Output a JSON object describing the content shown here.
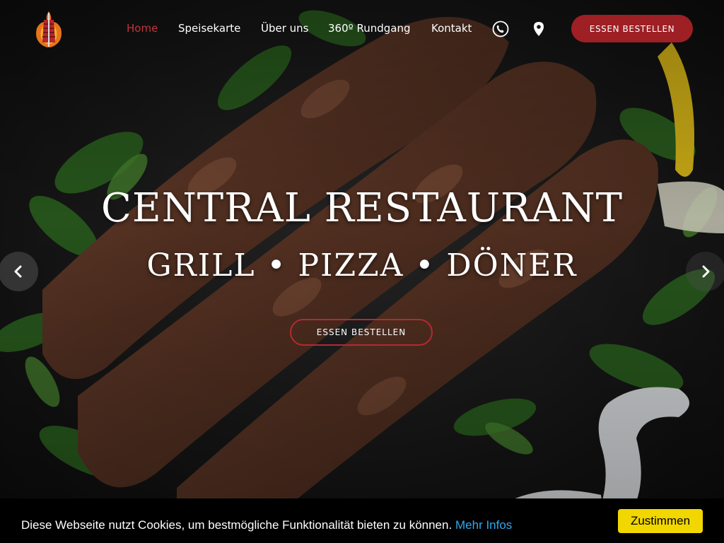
{
  "nav": {
    "items": [
      {
        "label": "Home",
        "active": true
      },
      {
        "label": "Speisekarte",
        "active": false
      },
      {
        "label": "Über uns",
        "active": false
      },
      {
        "label": "360º Rundgang",
        "active": false
      },
      {
        "label": "Kontakt",
        "active": false
      }
    ],
    "icons": [
      "phone-icon",
      "map-pin-icon"
    ],
    "order_button": "Essen bestellen"
  },
  "hero": {
    "title": "CENTRAL RESTAURANT",
    "subtitle": "GRILL • PIZZA • DÖNER",
    "button": "Essen bestellen"
  },
  "cookie_banner": {
    "text": "Diese Webseite nutzt Cookies, um bestmögliche Funktionalität bieten zu können.",
    "link": "Mehr Infos",
    "button": "Zustimmen"
  },
  "colors": {
    "accent": "#9e1f24",
    "active_nav": "#c0353d",
    "cookie_button": "#f1d600",
    "cookie_link": "#31a8f0"
  }
}
